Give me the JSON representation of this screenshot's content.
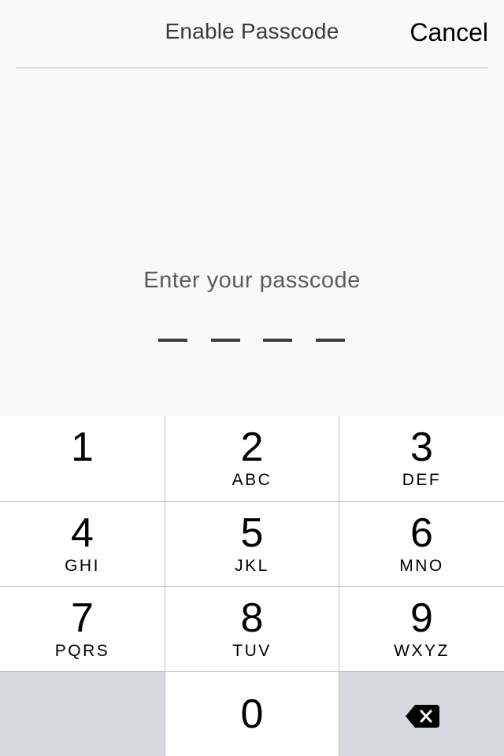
{
  "header": {
    "title": "Enable Passcode",
    "cancel_label": "Cancel"
  },
  "prompt": "Enter your passcode",
  "passcode": {
    "length": 4,
    "entered": 0
  },
  "keypad": {
    "keys": [
      {
        "digit": "1",
        "letters": ""
      },
      {
        "digit": "2",
        "letters": "ABC"
      },
      {
        "digit": "3",
        "letters": "DEF"
      },
      {
        "digit": "4",
        "letters": "GHI"
      },
      {
        "digit": "5",
        "letters": "JKL"
      },
      {
        "digit": "6",
        "letters": "MNO"
      },
      {
        "digit": "7",
        "letters": "PQRS"
      },
      {
        "digit": "8",
        "letters": "TUV"
      },
      {
        "digit": "9",
        "letters": "WXYZ"
      },
      {
        "digit": "0",
        "letters": ""
      }
    ],
    "backspace_icon": "backspace-icon"
  },
  "colors": {
    "background": "#f9f9f9",
    "keypad_gray": "#d5d8df",
    "key_divider": "#b9bcc4"
  }
}
